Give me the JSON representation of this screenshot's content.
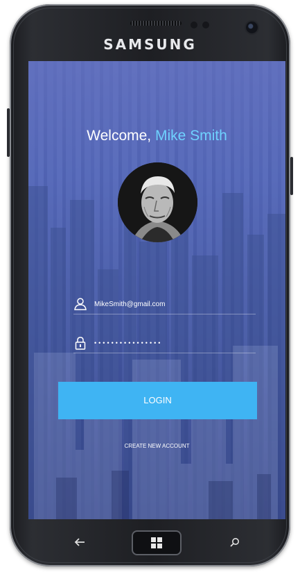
{
  "device": {
    "brand": "SAMSUNG",
    "icons": {
      "back": "back-arrow-icon",
      "home": "windows-logo-icon",
      "search": "search-icon",
      "camera": "front-camera-icon",
      "speaker": "earpiece-speaker-icon"
    }
  },
  "screen": {
    "welcome_prefix": "Welcome, ",
    "user_name": "Mike Smith",
    "avatar_icon": "user-portrait-photo",
    "email": {
      "icon": "user-icon",
      "value": "MikeSmith@gmail.com"
    },
    "password": {
      "icon": "lock-icon",
      "masked_value": "••••••••••••••••"
    },
    "login_label": "LOGIN",
    "create_account_label": "CREATE NEW ACCOUNT"
  },
  "colors": {
    "accent": "#3fb4f3",
    "name_highlight": "#6fd2ff",
    "overlay": "#4f63b5",
    "device_body": "#1e1f23"
  }
}
